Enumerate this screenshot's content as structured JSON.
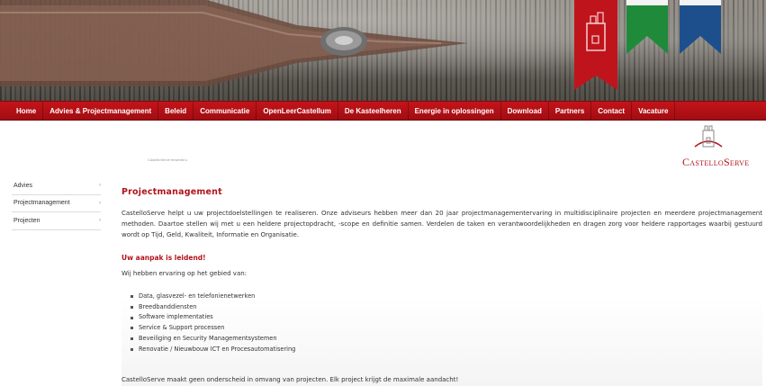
{
  "nav": {
    "items": [
      "Home",
      "Advies & Projectmanagement",
      "Beleid",
      "Communicatie",
      "OpenLeerCastellum",
      "De Kasteelheren",
      "Energie in oplossingen",
      "Download",
      "Partners",
      "Contact",
      "Vacature"
    ]
  },
  "header": {
    "tagline": "CastelloServe beweekt u",
    "logo_text": "CastelloServe"
  },
  "sidebar": {
    "items": [
      {
        "label": "Advies"
      },
      {
        "label": "Projectmanagement"
      },
      {
        "label": "Projecten"
      }
    ]
  },
  "main": {
    "title": "Projectmanagement",
    "intro": "CastelloServe helpt u uw projectdoelstellingen te realiseren. Onze adviseurs hebben meer dan 20 jaar projectmanagementervaring in multidisciplinaire projecten en meerdere projectmanagement methoden. Daartoe stellen wij met u een heldere projectopdracht, -scope en definitie samen. Verdelen de taken en verantwoordelijkheden en dragen zorg voor heldere rapportages waarbij gestuurd wordt op Tijd, Geld, Kwaliteit, Informatie en Organisatie.",
    "subtitle": "Uw aanpak is leidend!",
    "lead": "Wij hebben ervaring op het gebied van:",
    "bullets": [
      "Data, glasvezel- en telefonienetwerken",
      "Breedbanddiensten",
      "Software implementaties",
      "Service & Support processen",
      "Beveiliging en Security Managementsystemen",
      "Renovatie / Nieuwbouw ICT en Procesautomatisering"
    ],
    "closing": "CastelloServe maakt geen onderscheid in omvang van projecten. Elk project krijgt de maximale aandacht!"
  },
  "colors": {
    "brand_red": "#b0141a",
    "nav_red": "#c4141a",
    "pennant_green": "#1f8a3a",
    "pennant_blue": "#1d4f8c"
  },
  "icons": {
    "sidebar_chevron": "chevron-right-icon",
    "logo_mark": "castle-tower-icon"
  }
}
